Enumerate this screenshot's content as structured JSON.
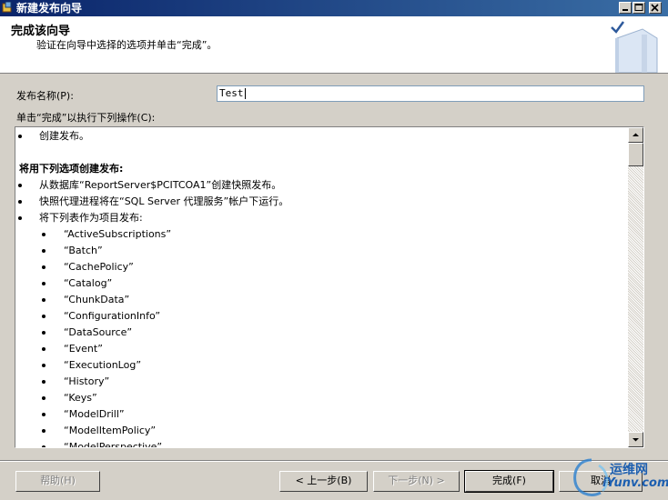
{
  "window": {
    "title": "新建发布向导"
  },
  "header": {
    "title": "完成该向导",
    "subtitle": "验证在向导中选择的选项并单击“完成”。"
  },
  "publication": {
    "name_label": "发布名称(P):",
    "name_value": "Test"
  },
  "actions": {
    "label": "单击“完成”以执行下列操作(C):",
    "lines": [
      {
        "text": "创建发布。",
        "level": 1
      },
      {
        "text": "",
        "level": 0
      },
      {
        "text": "将用下列选项创建发布:",
        "level": 0,
        "bold": true
      },
      {
        "text": "从数据库“ReportServer$PCITCOA1”创建快照发布。",
        "level": 1
      },
      {
        "text": "快照代理进程将在“SQL Server 代理服务”帐户下运行。",
        "level": 1
      },
      {
        "text": "将下列表作为项目发布:",
        "level": 1
      },
      {
        "text": "“ActiveSubscriptions”",
        "level": 2
      },
      {
        "text": "“Batch”",
        "level": 2
      },
      {
        "text": "“CachePolicy”",
        "level": 2
      },
      {
        "text": "“Catalog”",
        "level": 2
      },
      {
        "text": "“ChunkData”",
        "level": 2
      },
      {
        "text": "“ConfigurationInfo”",
        "level": 2
      },
      {
        "text": "“DataSource”",
        "level": 2
      },
      {
        "text": "“Event”",
        "level": 2
      },
      {
        "text": "“ExecutionLog”",
        "level": 2
      },
      {
        "text": "“History”",
        "level": 2
      },
      {
        "text": "“Keys”",
        "level": 2
      },
      {
        "text": "“ModelDrill”",
        "level": 2
      },
      {
        "text": "“ModelItemPolicy”",
        "level": 2
      },
      {
        "text": "“ModelPerspective”",
        "level": 2
      }
    ]
  },
  "buttons": {
    "help": "帮助(H)",
    "back": "< 上一步(B)",
    "next": "下一步(N) >",
    "finish": "完成(F)",
    "cancel": "取消"
  },
  "watermark": {
    "line1": "运维网",
    "line2": "iYunv.com"
  },
  "colors": {
    "titlebar": "#0a246a",
    "dialog": "#d4d0c8",
    "watermark": "#1d5fb0"
  }
}
